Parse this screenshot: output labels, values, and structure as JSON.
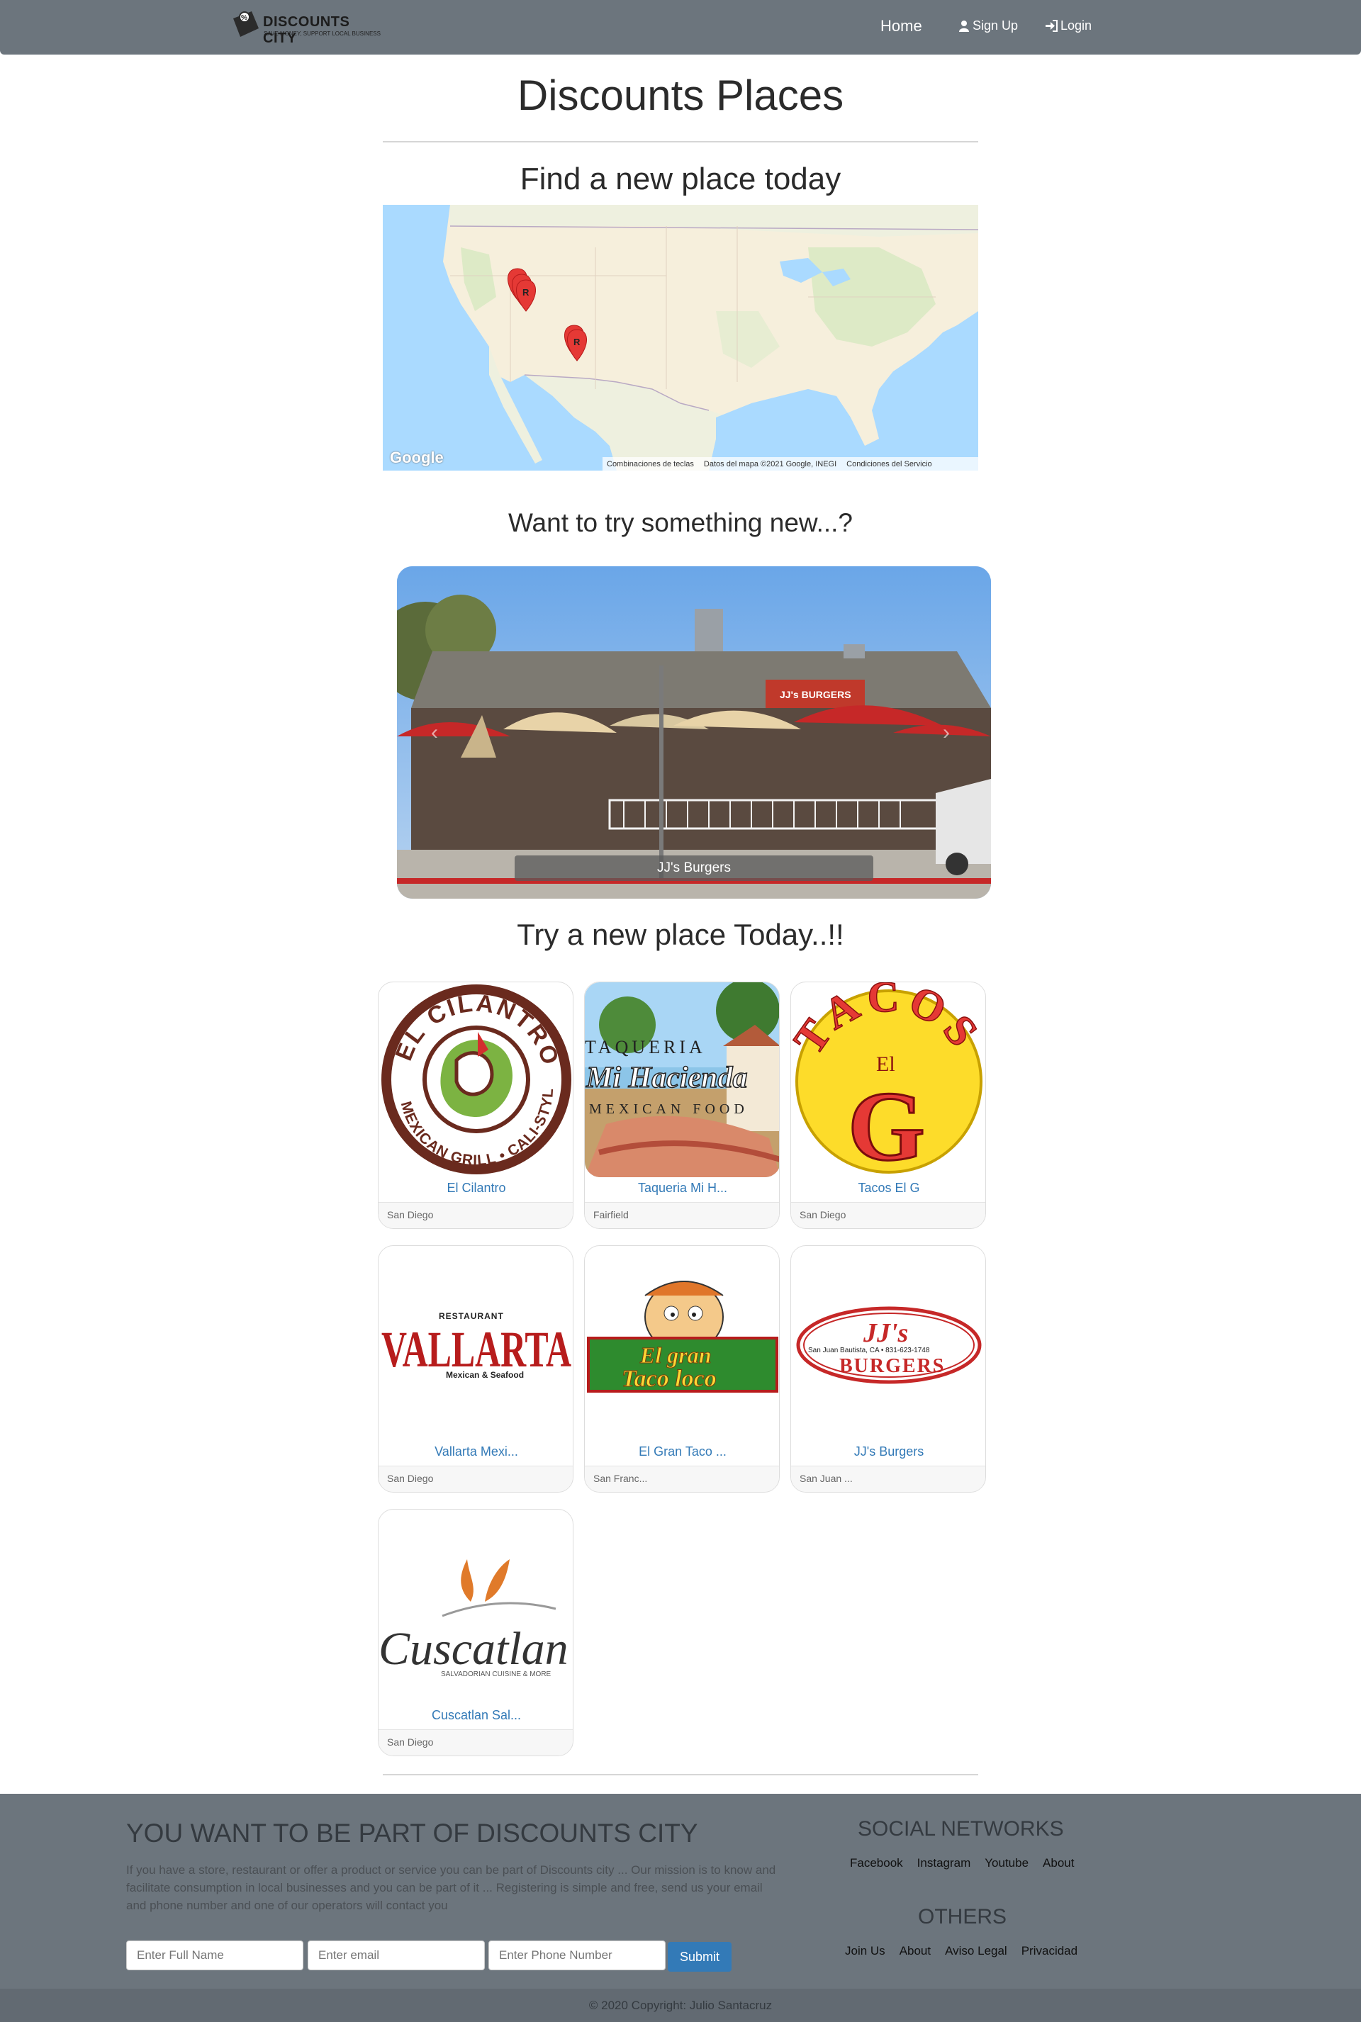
{
  "nav": {
    "brand_title": "DISCOUNTS CITY",
    "brand_sub": "SAVE MONEY, SUPPORT LOCAL BUSINESS",
    "home": "Home",
    "signup": "Sign Up",
    "login": "Login"
  },
  "page": {
    "title": "Discounts Places",
    "find_heading": "Find a new place today",
    "try_something": "Want to try something new...?",
    "try_today": "Try a new place Today..!!"
  },
  "map": {
    "provider": "Google",
    "footer": [
      "Combinaciones de teclas",
      "Datos del mapa ©2021 Google, INEGI",
      "Condiciones del Servicio"
    ],
    "marker_label": "R"
  },
  "carousel": {
    "caption": "JJ's Burgers",
    "sign_text": "JJ's BURGERS"
  },
  "places": [
    {
      "name": "El Cilantro",
      "city": "San Diego",
      "logo_text": [
        "EL CILANTRO",
        "MEXICAN GRILL • CALI-STYLE"
      ]
    },
    {
      "name": "Taqueria Mi H...",
      "city": "Fairfield",
      "logo_text": [
        "TAQUERIA",
        "Mi Hacienda",
        "MEXICAN FOOD"
      ]
    },
    {
      "name": "Tacos El G",
      "city": "San Diego",
      "logo_text": [
        "TACOS",
        "El",
        "G"
      ]
    },
    {
      "name": "Vallarta Mexi...",
      "city": "San Diego",
      "logo_text": [
        "RESTAURANT",
        "VALLARTA",
        "Mexican & Seafood"
      ]
    },
    {
      "name": "El Gran Taco ...",
      "city": "San Franc...",
      "logo_text": [
        "El gran",
        "Taco loco"
      ]
    },
    {
      "name": "JJ's Burgers",
      "city": "San Juan ...",
      "logo_text": [
        "JJ's",
        "San Juan Bautista, CA • 831-623-1748",
        "BURGERS"
      ]
    },
    {
      "name": "Cuscatlan Sal...",
      "city": "San Diego",
      "logo_text": [
        "Cuscatlan",
        "SALVADORIAN CUISINE & MORE"
      ]
    }
  ],
  "footer": {
    "title": "YOU WANT TO BE PART OF DISCOUNTS CITY",
    "text": "If you have a store, restaurant or offer a product or service you can be part of Discounts city ... Our mission is to know and facilitate consumption in local businesses and you can be part of it ... Registering is simple and free, send us your email and phone number and one of our operators will contact you",
    "name_placeholder": "Enter Full Name",
    "email_placeholder": "Enter email",
    "phone_placeholder": "Enter Phone Number",
    "submit": "Submit",
    "social_title": "SOCIAL NETWORKS",
    "social_links": [
      "Facebook",
      "Instagram",
      "Youtube",
      "About"
    ],
    "others_title": "OTHERS",
    "others_links": [
      "Join Us",
      "About",
      "Aviso Legal",
      "Privacidad"
    ],
    "copyright": "© 2020 Copyright: Julio Santacruz"
  },
  "colors": {
    "navbar": "#6c757d",
    "link": "#337ab7",
    "submit": "#337ab7",
    "marker": "#e53935"
  }
}
